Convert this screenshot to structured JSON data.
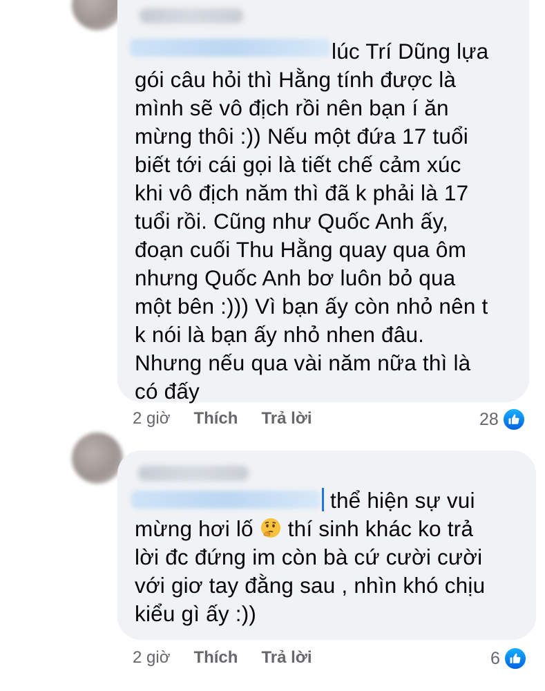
{
  "comments": [
    {
      "text_lines": [
        "lúc Trí Dũng lựa",
        "gói câu hỏi thì Hằng tính được là",
        "mình sẽ vô địch rồi nên bạn í ăn",
        "mừng thôi :)) Nếu một đứa 17 tuổi",
        "biết tới cái gọi là tiết chế cảm xúc",
        "khi vô địch năm thì đã k phải là 17",
        "tuổi rồi. Cũng như Quốc Anh ấy,",
        "đoạn cuối Thu Hằng quay qua ôm",
        "nhưng Quốc Anh bơ luôn bỏ qua",
        "một bên :))) Vì bạn ấy còn nhỏ nên t",
        "k nói là bạn ấy nhỏ nhen đâu.",
        "Nhưng nếu qua vài năm nữa thì là",
        "có đấy"
      ],
      "time": "2 giờ",
      "like_label": "Thích",
      "reply_label": "Trả lời",
      "reaction_count": "28"
    },
    {
      "text_lines": [
        "thể hiện sự vui",
        "mừng hơi lố",
        "thí sinh khác ko trả",
        "lời đc đứng im còn bà cứ cười cười",
        "với giơ tay đằng sau , nhìn khó chịu",
        "kiểu gì ấy :))"
      ],
      "emoji": "thinking-face",
      "time": "2 giờ",
      "like_label": "Thích",
      "reply_label": "Trả lời",
      "reaction_count": "6"
    }
  ],
  "colors": {
    "bubble": "#f0f2f5",
    "meta_text": "#65676b",
    "like_blue": "#1877f2"
  }
}
